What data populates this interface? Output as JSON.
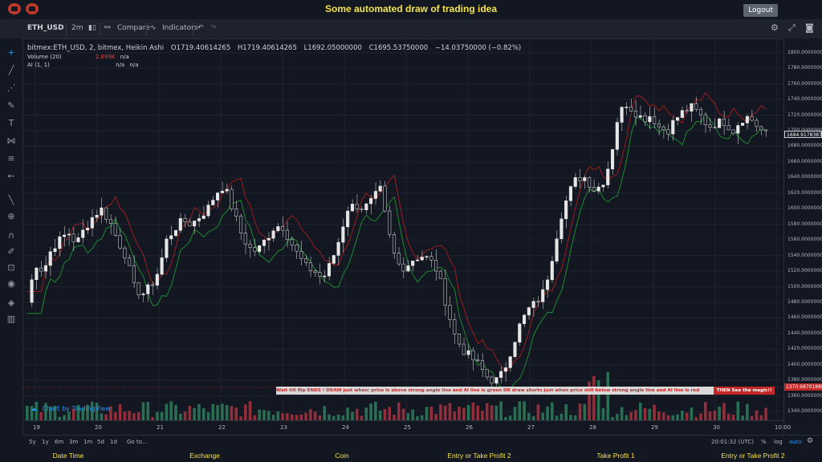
{
  "app": {
    "title": "Some automated draw of trading idea",
    "logout_label": "Logout"
  },
  "toolbar": {
    "symbol": "ETH_USD",
    "interval": "2m",
    "compare_label": "Compare",
    "indicators_label": "Indicators"
  },
  "legend": {
    "symbol_line": "bitmex:ETH_USD, 2, bitmex, Heikin Ashi",
    "open": "O1719.40614265",
    "high": "H1719.40614265",
    "low": "L1692.05000000",
    "close": "C1695.53750000",
    "change": "−14.03750000 (−0.82%)",
    "volume_title": "Volume (20)",
    "volume_value": "2.899K",
    "volume_na": "n/a",
    "ai_title": "AI (1, 1)",
    "ai_na1": "n/a",
    "ai_na2": "n/a"
  },
  "price_axis": {
    "labels": [
      "1800.00000000",
      "1780.00000000",
      "1760.00000000",
      "1740.00000000",
      "1720.00000000",
      "1700.00000000",
      "1680.00000000",
      "1660.00000000",
      "1640.00000000",
      "1620.00000000",
      "1600.00000000",
      "1580.00000000",
      "1560.00000000",
      "1540.00000000",
      "1520.00000000",
      "1500.00000000",
      "1480.00000000",
      "1460.00000000",
      "1440.00000000",
      "1420.00000000",
      "1400.00000000",
      "1380.00000000",
      "1360.00000000",
      "1340.00000000"
    ],
    "current_price": "1694.91783871",
    "marker_price": "1370.98701888"
  },
  "time_axis": {
    "dates": [
      "19",
      "20",
      "21",
      "22",
      "23",
      "24",
      "25",
      "26",
      "27",
      "28",
      "29",
      "30",
      "10:00"
    ]
  },
  "note": {
    "text": "Wait till flip ENDS  !   DRAW just when:  price is above strong angle line and AI line is green          DR          draw shorts just when price still below strong angle line and AI line is red",
    "end": "THEN See the magic!!"
  },
  "branding": {
    "tv_label": "Chart by TradingView"
  },
  "range_bar": {
    "ranges": [
      "5y",
      "1y",
      "6m",
      "3m",
      "1m",
      "5d",
      "1d"
    ],
    "goto": "Go to...",
    "clock": "20:01:32 (UTC)",
    "percent": "%",
    "log": "log",
    "auto": "auto"
  },
  "footer": {
    "labels": [
      "Date Time",
      "Exchange",
      "Coin",
      "Entry or Take Profit 2",
      "Take Profit 1",
      "Entry or Take Profit 2"
    ]
  },
  "colors": {
    "background": "#131722",
    "title": "#f5e34a",
    "up_volume": "#2e7d5b",
    "down_volume": "#a8323e",
    "ai_green": "#1b8a2f",
    "ai_red": "#9b1c1c",
    "candle": "#e6e6e6"
  },
  "chart_data": {
    "type": "candlestick",
    "title": "bitmex:ETH_USD, 2, bitmex, Heikin Ashi",
    "ylim": [
      1335,
      1810
    ],
    "x_ticks": [
      "19",
      "20",
      "21",
      "22",
      "23",
      "24",
      "25",
      "26",
      "27",
      "28",
      "29",
      "30",
      "10:00"
    ],
    "close_path_points": [
      [
        0,
        1480
      ],
      [
        10,
        1530
      ],
      [
        20,
        1520
      ],
      [
        30,
        1550
      ],
      [
        40,
        1560
      ],
      [
        50,
        1570
      ],
      [
        60,
        1555
      ],
      [
        70,
        1575
      ],
      [
        80,
        1590
      ],
      [
        90,
        1600
      ],
      [
        100,
        1585
      ],
      [
        110,
        1560
      ],
      [
        120,
        1540
      ],
      [
        130,
        1500
      ],
      [
        140,
        1490
      ],
      [
        150,
        1500
      ],
      [
        160,
        1520
      ],
      [
        170,
        1560
      ],
      [
        180,
        1575
      ],
      [
        190,
        1585
      ],
      [
        200,
        1580
      ],
      [
        210,
        1590
      ],
      [
        220,
        1600
      ],
      [
        230,
        1620
      ],
      [
        240,
        1630
      ],
      [
        250,
        1600
      ],
      [
        260,
        1570
      ],
      [
        270,
        1550
      ],
      [
        280,
        1545
      ],
      [
        290,
        1560
      ],
      [
        300,
        1575
      ],
      [
        310,
        1580
      ],
      [
        320,
        1560
      ],
      [
        330,
        1540
      ],
      [
        340,
        1525
      ],
      [
        350,
        1520
      ],
      [
        360,
        1510
      ],
      [
        370,
        1530
      ],
      [
        380,
        1560
      ],
      [
        390,
        1600
      ],
      [
        400,
        1605
      ],
      [
        410,
        1600
      ],
      [
        420,
        1610
      ],
      [
        430,
        1625
      ],
      [
        440,
        1570
      ],
      [
        450,
        1530
      ],
      [
        460,
        1525
      ],
      [
        470,
        1535
      ],
      [
        480,
        1540
      ],
      [
        490,
        1535
      ],
      [
        500,
        1520
      ],
      [
        510,
        1480
      ],
      [
        520,
        1440
      ],
      [
        530,
        1420
      ],
      [
        540,
        1410
      ],
      [
        550,
        1400
      ],
      [
        560,
        1385
      ],
      [
        570,
        1378
      ],
      [
        580,
        1390
      ],
      [
        590,
        1420
      ],
      [
        600,
        1450
      ],
      [
        610,
        1470
      ],
      [
        620,
        1480
      ],
      [
        630,
        1495
      ],
      [
        640,
        1540
      ],
      [
        650,
        1590
      ],
      [
        660,
        1620
      ],
      [
        670,
        1640
      ],
      [
        680,
        1640
      ],
      [
        690,
        1625
      ],
      [
        700,
        1630
      ],
      [
        710,
        1660
      ],
      [
        720,
        1720
      ],
      [
        730,
        1735
      ],
      [
        740,
        1725
      ],
      [
        750,
        1715
      ],
      [
        760,
        1720
      ],
      [
        770,
        1705
      ],
      [
        780,
        1700
      ],
      [
        790,
        1715
      ],
      [
        800,
        1725
      ],
      [
        810,
        1730
      ],
      [
        820,
        1720
      ],
      [
        830,
        1705
      ],
      [
        840,
        1710
      ],
      [
        850,
        1712
      ],
      [
        860,
        1700
      ],
      [
        870,
        1715
      ],
      [
        880,
        1718
      ],
      [
        890,
        1705
      ],
      [
        900,
        1695
      ]
    ]
  }
}
